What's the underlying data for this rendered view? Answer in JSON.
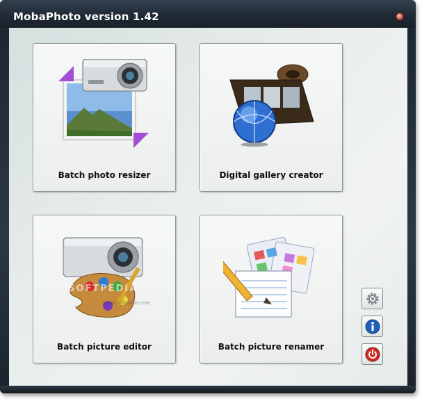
{
  "window": {
    "title": "MobaPhoto version 1.42"
  },
  "tiles": [
    {
      "label": "Batch photo resizer",
      "icon": "camera-resize-icon"
    },
    {
      "label": "Digital gallery creator",
      "icon": "film-globe-icon"
    },
    {
      "label": "Batch picture editor",
      "icon": "camera-palette-icon"
    },
    {
      "label": "Batch picture renamer",
      "icon": "notepad-pencil-icon"
    }
  ],
  "side_buttons": [
    {
      "icon": "gear-icon",
      "color": "#7e8a8a"
    },
    {
      "icon": "info-icon",
      "color": "#1f5fb8"
    },
    {
      "icon": "power-icon",
      "color": "#d02b22"
    }
  ],
  "watermark": "SOFTPEDIA",
  "watermark_url": "www.softpedia.com"
}
